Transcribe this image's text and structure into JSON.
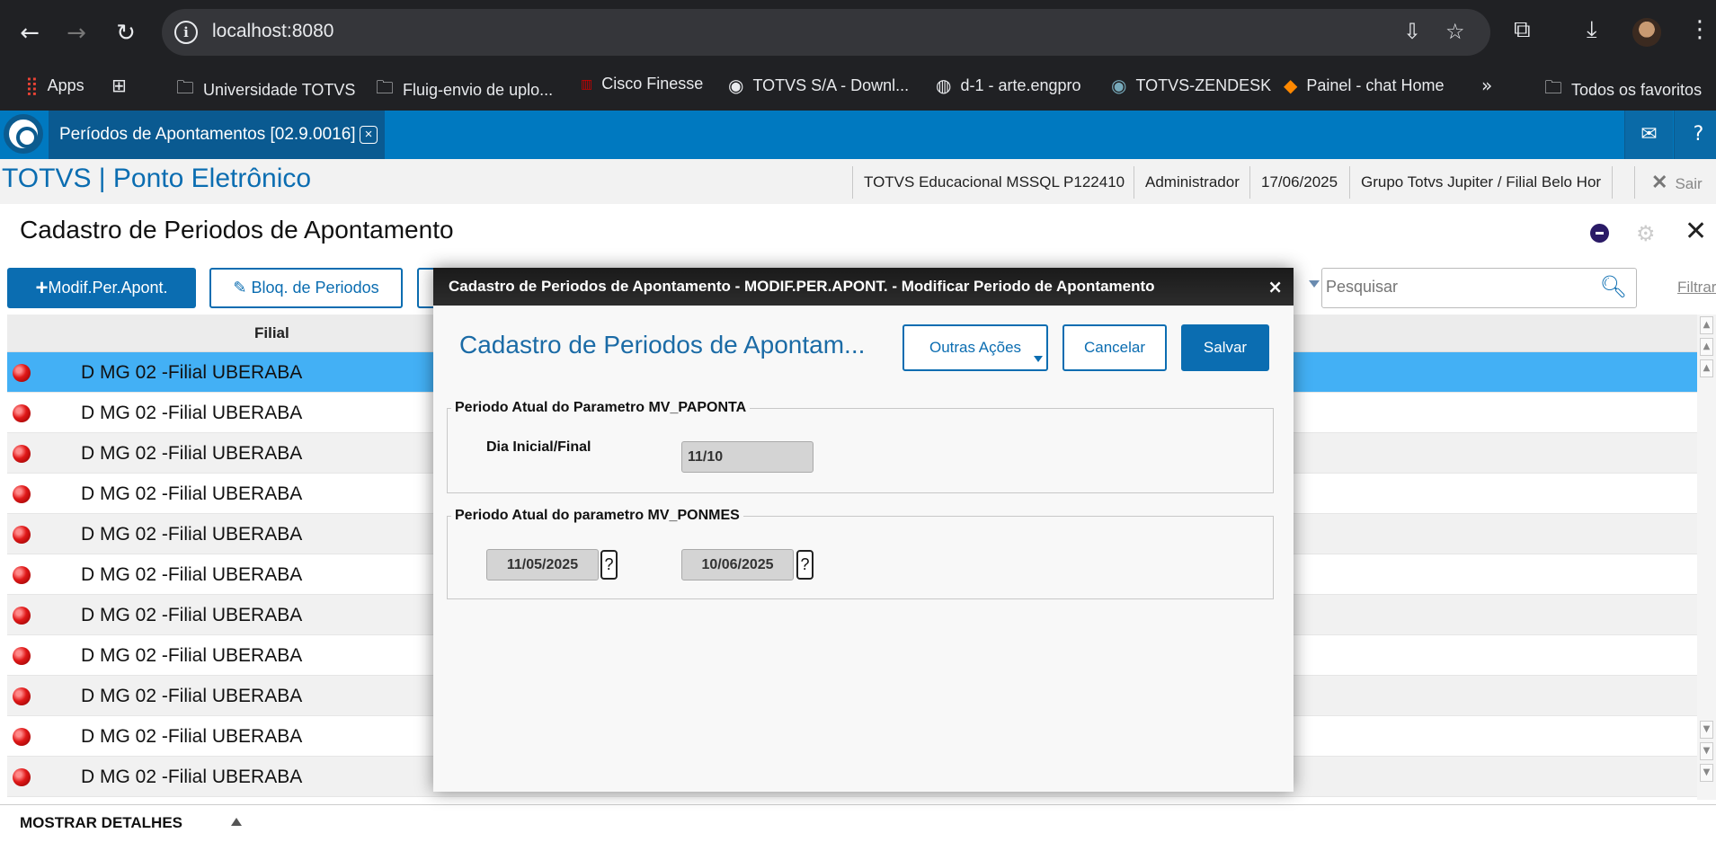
{
  "browser": {
    "url": "localhost:8080",
    "bookmarks": [
      {
        "label": "Apps"
      },
      {
        "label": ""
      },
      {
        "label": "Universidade TOTVS"
      },
      {
        "label": "Fluig-envio de uplo..."
      },
      {
        "label": "Cisco Finesse"
      },
      {
        "label": "TOTVS S/A - Downl..."
      },
      {
        "label": "d-1 - arte.engpro"
      },
      {
        "label": "TOTVS-ZENDESK"
      },
      {
        "label": "Painel - chat Home"
      },
      {
        "label": "Todos os favoritos"
      }
    ]
  },
  "app": {
    "tab_label": "Períodos de Apontamentos [02.9.0016]",
    "title": "TOTVS | Ponto Eletrônico",
    "environment": "TOTVS Educacional MSSQL P122410",
    "user": "Administrador",
    "date": "17/06/2025",
    "branch": "Grupo Totvs Jupiter / Filial Belo Hor",
    "logout": "Sair"
  },
  "page": {
    "title": "Cadastro de Periodos de Apontamento",
    "actions": {
      "modify": "Modif.Per.Apont.",
      "block": "Bloq. de Periodos"
    },
    "search_placeholder": "Pesquisar",
    "filter": "Filtrar",
    "grid": {
      "column": "Filial",
      "rows": [
        "D MG 02 -Filial UBERABA",
        "D MG 02 -Filial UBERABA",
        "D MG 02 -Filial UBERABA",
        "D MG 02 -Filial UBERABA",
        "D MG 02 -Filial UBERABA",
        "D MG 02 -Filial UBERABA",
        "D MG 02 -Filial UBERABA",
        "D MG 02 -Filial UBERABA",
        "D MG 02 -Filial UBERABA",
        "D MG 02 -Filial UBERABA",
        "D MG 02 -Filial UBERABA"
      ]
    },
    "details": "MOSTRAR DETALHES"
  },
  "modal": {
    "header": "Cadastro de Periodos de Apontamento - MODIF.PER.APONT. - Modificar Periodo de Apontamento",
    "title": "Cadastro de Periodos de Apontam...",
    "buttons": {
      "other": "Outras Ações",
      "cancel": "Cancelar",
      "save": "Salvar"
    },
    "group1": {
      "legend": "Periodo Atual do Parametro MV_PAPONTA",
      "label": "Dia Inicial/Final",
      "value": "11/10"
    },
    "group2": {
      "legend": "Periodo Atual do parametro MV_PONMES",
      "start": "11/05/2025",
      "end": "10/06/2025",
      "help": "?"
    }
  }
}
